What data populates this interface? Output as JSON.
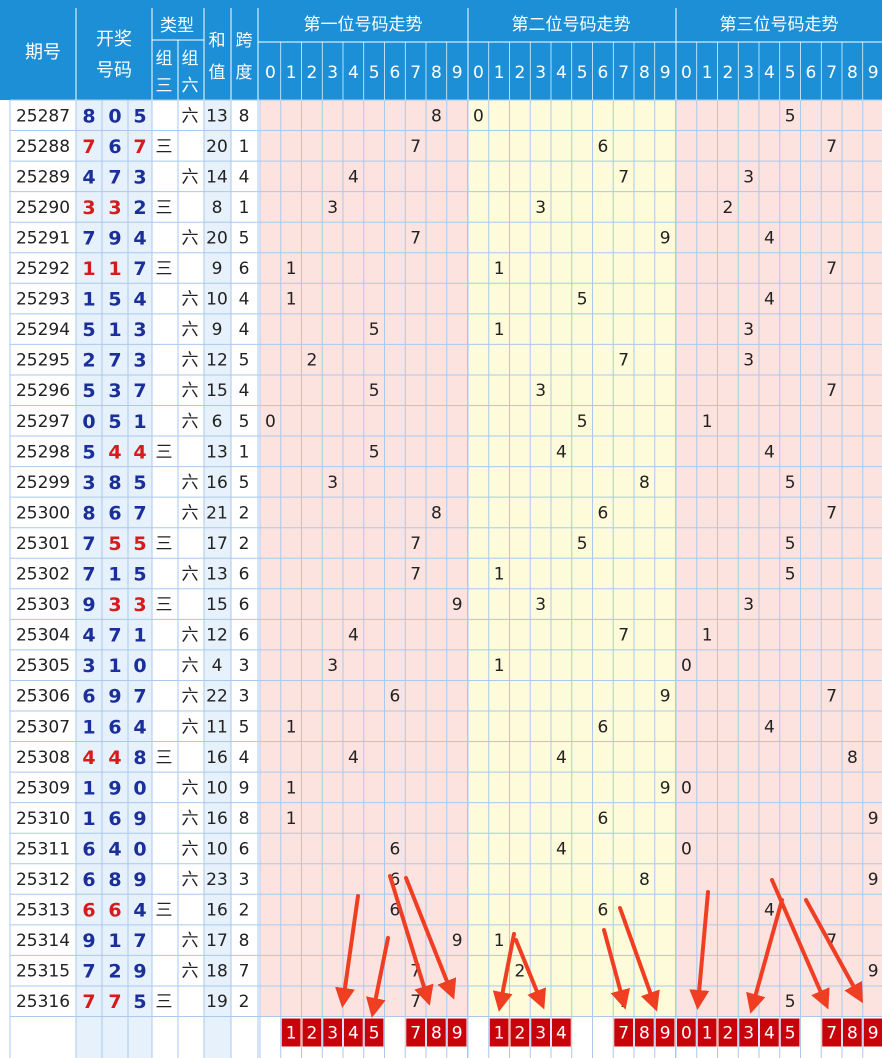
{
  "header": {
    "issue": "期号",
    "draw_line1": "开奖",
    "draw_line2": "号码",
    "type": "类型",
    "group3_a": "组",
    "group3_b": "三",
    "group6_a": "组",
    "group6_b": "六",
    "sum_a": "和",
    "sum_b": "值",
    "span_a": "跨",
    "span_b": "度",
    "pos1": "第一位号码走势",
    "pos2": "第二位号码走势",
    "pos3": "第三位号码走势",
    "digits": [
      "0",
      "1",
      "2",
      "3",
      "4",
      "5",
      "6",
      "7",
      "8",
      "9"
    ]
  },
  "colors": {
    "header_bg": "#1c8fd6",
    "pos1_bg": "#fde3e0",
    "pos2_bg": "#fdfbd9",
    "pos3_bg": "#fde3e0",
    "repeat_digit": "#d51b1b",
    "normal_digit": "#1a2f9a",
    "pick_box": "#c8040b",
    "arrow": "#ef3e22",
    "grid": "#a9c9ee"
  },
  "chart_data": {
    "type": "table",
    "title": "",
    "columns": [
      "期号",
      "开奖号码",
      "组三",
      "组六",
      "和值",
      "跨度",
      "第一位号码走势",
      "第二位号码走势",
      "第三位号码走势"
    ],
    "group3_label": "三",
    "group6_label": "六",
    "rows": [
      {
        "issue": "25287",
        "digits": [
          8,
          0,
          5
        ],
        "type": "六",
        "sum": 13,
        "span": 8
      },
      {
        "issue": "25288",
        "digits": [
          7,
          6,
          7
        ],
        "type": "三",
        "sum": 20,
        "span": 1
      },
      {
        "issue": "25289",
        "digits": [
          4,
          7,
          3
        ],
        "type": "六",
        "sum": 14,
        "span": 4
      },
      {
        "issue": "25290",
        "digits": [
          3,
          3,
          2
        ],
        "type": "三",
        "sum": 8,
        "span": 1
      },
      {
        "issue": "25291",
        "digits": [
          7,
          9,
          4
        ],
        "type": "六",
        "sum": 20,
        "span": 5
      },
      {
        "issue": "25292",
        "digits": [
          1,
          1,
          7
        ],
        "type": "三",
        "sum": 9,
        "span": 6
      },
      {
        "issue": "25293",
        "digits": [
          1,
          5,
          4
        ],
        "type": "六",
        "sum": 10,
        "span": 4
      },
      {
        "issue": "25294",
        "digits": [
          5,
          1,
          3
        ],
        "type": "六",
        "sum": 9,
        "span": 4
      },
      {
        "issue": "25295",
        "digits": [
          2,
          7,
          3
        ],
        "type": "六",
        "sum": 12,
        "span": 5
      },
      {
        "issue": "25296",
        "digits": [
          5,
          3,
          7
        ],
        "type": "六",
        "sum": 15,
        "span": 4
      },
      {
        "issue": "25297",
        "digits": [
          0,
          5,
          1
        ],
        "type": "六",
        "sum": 6,
        "span": 5
      },
      {
        "issue": "25298",
        "digits": [
          5,
          4,
          4
        ],
        "type": "三",
        "sum": 13,
        "span": 1
      },
      {
        "issue": "25299",
        "digits": [
          3,
          8,
          5
        ],
        "type": "六",
        "sum": 16,
        "span": 5
      },
      {
        "issue": "25300",
        "digits": [
          8,
          6,
          7
        ],
        "type": "六",
        "sum": 21,
        "span": 2
      },
      {
        "issue": "25301",
        "digits": [
          7,
          5,
          5
        ],
        "type": "三",
        "sum": 17,
        "span": 2
      },
      {
        "issue": "25302",
        "digits": [
          7,
          1,
          5
        ],
        "type": "六",
        "sum": 13,
        "span": 6
      },
      {
        "issue": "25303",
        "digits": [
          9,
          3,
          3
        ],
        "type": "三",
        "sum": 15,
        "span": 6
      },
      {
        "issue": "25304",
        "digits": [
          4,
          7,
          1
        ],
        "type": "六",
        "sum": 12,
        "span": 6
      },
      {
        "issue": "25305",
        "digits": [
          3,
          1,
          0
        ],
        "type": "六",
        "sum": 4,
        "span": 3
      },
      {
        "issue": "25306",
        "digits": [
          6,
          9,
          7
        ],
        "type": "六",
        "sum": 22,
        "span": 3
      },
      {
        "issue": "25307",
        "digits": [
          1,
          6,
          4
        ],
        "type": "六",
        "sum": 11,
        "span": 5
      },
      {
        "issue": "25308",
        "digits": [
          4,
          4,
          8
        ],
        "type": "三",
        "sum": 16,
        "span": 4
      },
      {
        "issue": "25309",
        "digits": [
          1,
          9,
          0
        ],
        "type": "六",
        "sum": 10,
        "span": 9
      },
      {
        "issue": "25310",
        "digits": [
          1,
          6,
          9
        ],
        "type": "六",
        "sum": 16,
        "span": 8
      },
      {
        "issue": "25311",
        "digits": [
          6,
          4,
          0
        ],
        "type": "六",
        "sum": 10,
        "span": 6
      },
      {
        "issue": "25312",
        "digits": [
          6,
          8,
          9
        ],
        "type": "六",
        "sum": 23,
        "span": 3
      },
      {
        "issue": "25313",
        "digits": [
          6,
          6,
          4
        ],
        "type": "三",
        "sum": 16,
        "span": 2
      },
      {
        "issue": "25314",
        "digits": [
          9,
          1,
          7
        ],
        "type": "六",
        "sum": 17,
        "span": 8
      },
      {
        "issue": "25315",
        "digits": [
          7,
          2,
          9
        ],
        "type": "六",
        "sum": 18,
        "span": 7
      },
      {
        "issue": "25316",
        "digits": [
          7,
          7,
          5
        ],
        "type": "三",
        "sum": 19,
        "span": 2
      }
    ],
    "picks": {
      "pos1": [
        1,
        2,
        3,
        4,
        5,
        7,
        8,
        9
      ],
      "pos2": [
        1,
        2,
        3,
        4,
        7,
        8,
        9
      ],
      "pos3": [
        0,
        1,
        2,
        3,
        4,
        5,
        7,
        8,
        9
      ]
    }
  }
}
